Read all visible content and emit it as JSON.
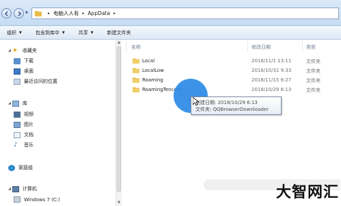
{
  "address_bar": {
    "path": [
      "电脑人人有",
      "AppData"
    ]
  },
  "toolbar": {
    "organize": "组织",
    "include_in_library": "包含到库中",
    "share": "共享",
    "new_folder": "新建文件夹"
  },
  "nav": {
    "favorites": "收藏夹",
    "downloads": "下载",
    "desktop": "桌面",
    "recent": "最近访问的位置",
    "libraries": "库",
    "videos": "视频",
    "pictures": "图片",
    "documents": "文档",
    "music": "音乐",
    "homegroup": "家庭组",
    "computer": "计算机",
    "drive_c": "Windows 7 (C:)"
  },
  "columns": {
    "name": "名称",
    "date": "修改日期",
    "type": "类型"
  },
  "files": [
    {
      "name": "Local",
      "date": "2018/11/1 13:11",
      "type": "文件夹"
    },
    {
      "name": "LocalLow",
      "date": "2018/10/31 9:33",
      "type": "文件夹"
    },
    {
      "name": "Roaming",
      "date": "2018/11/15 6:27",
      "type": "文件夹"
    },
    {
      "name": "RoamingTencent",
      "date": "2018/10/29 6:13",
      "type": "文件夹"
    }
  ],
  "tooltip": {
    "line1": "创建日期: 2018/10/29 6:13",
    "line2": "文件夹: QQBrowserDownloader"
  },
  "watermark": "大智网汇",
  "colors": {
    "folder": "#e8bd4c",
    "highlight": "#2b8ae6"
  }
}
